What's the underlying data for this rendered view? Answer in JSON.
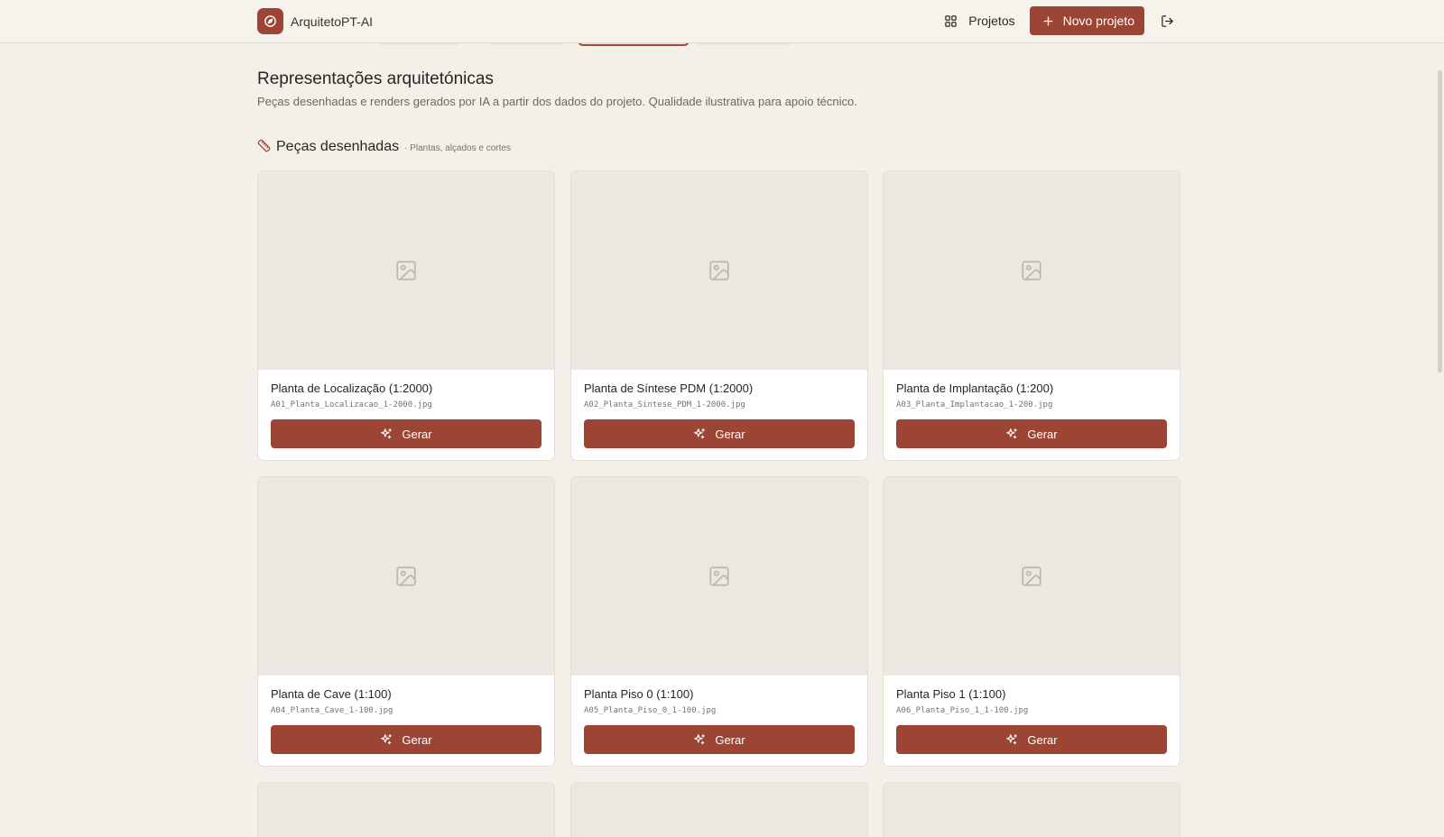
{
  "app": {
    "name": "ArquitetoPT-AI"
  },
  "nav": {
    "projects_label": "Projetos",
    "new_project_label": "Novo projeto"
  },
  "page": {
    "title": "Representações arquitetónicas",
    "subtitle": "Peças desenhadas e renders gerados por IA a partir dos dados do projeto. Qualidade ilustrativa para apoio técnico."
  },
  "section": {
    "title": "Peças desenhadas",
    "subtitle": "· Plantas, alçados e cortes"
  },
  "cards": [
    {
      "title": "Planta de Localização (1:2000)",
      "file": "A01_Planta_Localizacao_1-2000.jpg",
      "button": "Gerar"
    },
    {
      "title": "Planta de Síntese PDM (1:2000)",
      "file": "A02_Planta_Sintese_PDM_1-2000.jpg",
      "button": "Gerar"
    },
    {
      "title": "Planta de Implantação (1:200)",
      "file": "A03_Planta_Implantacao_1-200.jpg",
      "button": "Gerar"
    },
    {
      "title": "Planta de Cave (1:100)",
      "file": "A04_Planta_Cave_1-100.jpg",
      "button": "Gerar"
    },
    {
      "title": "Planta Piso 0 (1:100)",
      "file": "A05_Planta_Piso_0_1-100.jpg",
      "button": "Gerar"
    },
    {
      "title": "Planta Piso 1 (1:100)",
      "file": "A06_Planta_Piso_1_1-100.jpg",
      "button": "Gerar"
    }
  ],
  "colors": {
    "accent": "#9c4535",
    "background": "#f3f0e9",
    "placeholder": "#ece8e1"
  }
}
